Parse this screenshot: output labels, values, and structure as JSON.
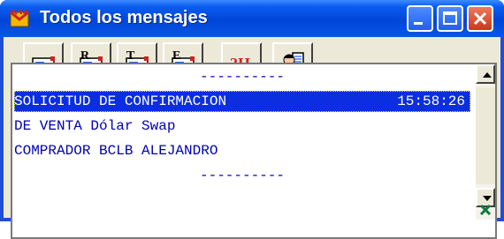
{
  "window": {
    "title": "Todos los mensajes"
  },
  "title_buttons": [
    "minimize",
    "maximize",
    "close"
  ],
  "toolbar": {
    "buttons": [
      {
        "icon": "envelope-icon",
        "label": ""
      },
      {
        "icon": "envelope-r-icon",
        "label": "R"
      },
      {
        "icon": "envelope-t-icon",
        "label": "T"
      },
      {
        "icon": "envelope-e-icon",
        "label": "E"
      },
      {
        "icon": "help-icon",
        "label": "?H"
      },
      {
        "icon": "user-document-icon",
        "label": ""
      }
    ]
  },
  "messages": [
    {
      "text": "----------",
      "time": "",
      "selected": false,
      "align": "center"
    },
    {
      "text": "SOLICITUD DE CONFIRMACION",
      "time": "15:58:26",
      "selected": true,
      "align": "left"
    },
    {
      "text": "DE VENTA Dólar Swap",
      "time": "",
      "selected": false,
      "align": "left"
    },
    {
      "text": "COMPRADOR BCLB ALEJANDRO",
      "time": "",
      "selected": false,
      "align": "left"
    },
    {
      "text": "----------",
      "time": "",
      "selected": false,
      "align": "center"
    }
  ],
  "colors": {
    "titlebar": "#0046d8",
    "selection": "#0b2ee0",
    "list_text": "#0000b0",
    "frame": "#ece9d8"
  }
}
